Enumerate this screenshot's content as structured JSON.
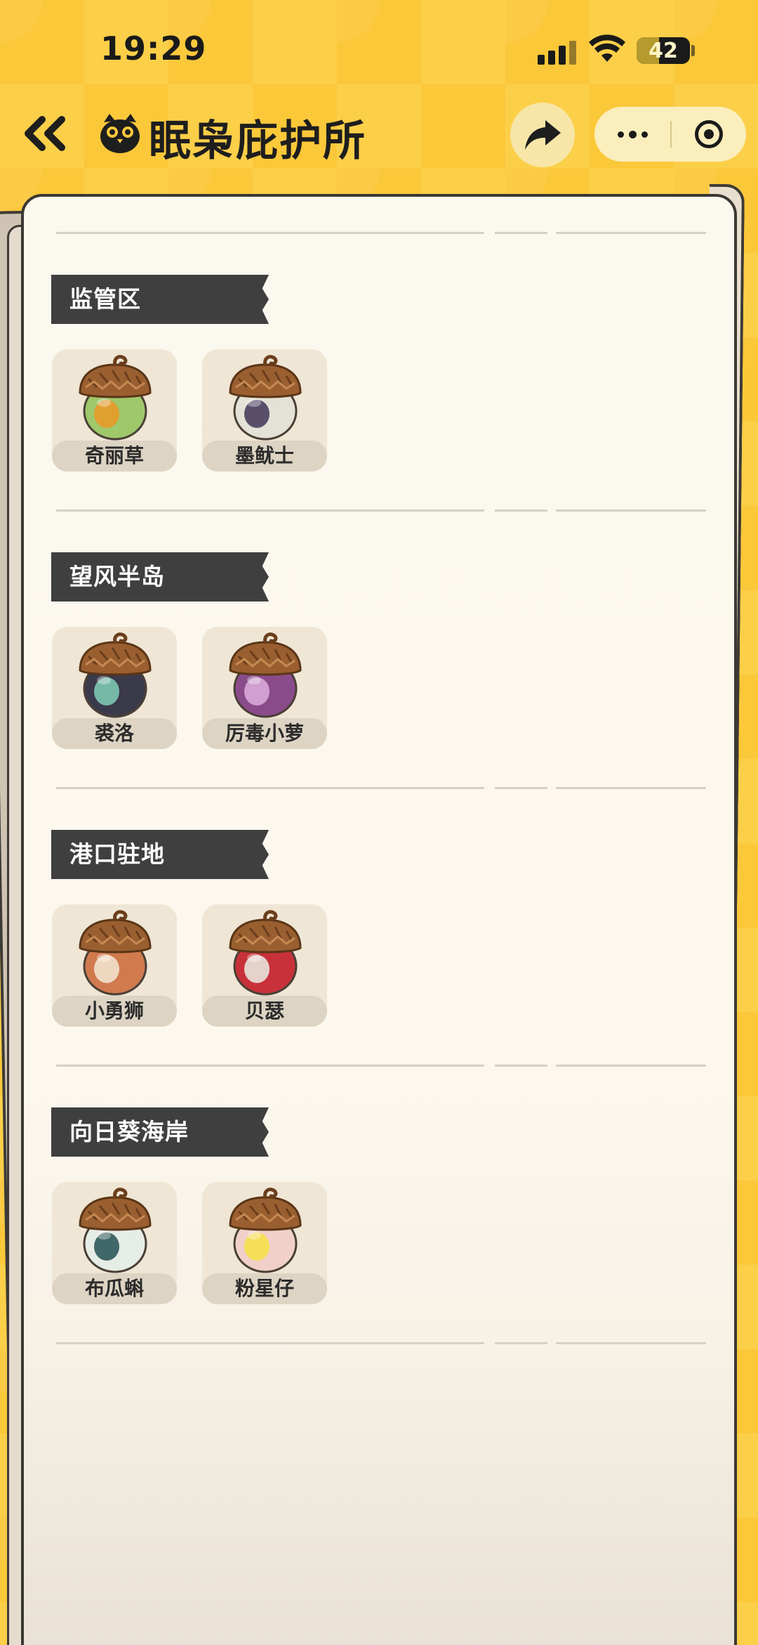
{
  "status_bar": {
    "time": "19:29",
    "battery": "42",
    "battery_percent": 42
  },
  "nav": {
    "title": "眠枭庇护所",
    "back_icon": "double-chevron-left-icon",
    "share_icon": "share-arrow-icon",
    "logo_icon": "owl-logo-icon"
  },
  "sections": [
    {
      "title": "监管区",
      "items": [
        {
          "name": "奇丽草",
          "body": "#9fc86a",
          "accent": "#e89a2a",
          "icon": "acorn-icon"
        },
        {
          "name": "墨鱿士",
          "body": "#e4e2d6",
          "accent": "#4a3f5e",
          "icon": "acorn-icon"
        }
      ]
    },
    {
      "title": "望风半岛",
      "items": [
        {
          "name": "裘洛",
          "body": "#3a3a4a",
          "accent": "#7ec7b1",
          "icon": "acorn-icon"
        },
        {
          "name": "厉毒小萝",
          "body": "#8a4b8a",
          "accent": "#d8a9d8",
          "icon": "acorn-icon"
        }
      ]
    },
    {
      "title": "港口驻地",
      "items": [
        {
          "name": "小勇狮",
          "body": "#d07a4e",
          "accent": "#f2e1cc",
          "icon": "acorn-icon"
        },
        {
          "name": "贝瑟",
          "body": "#c8313a",
          "accent": "#e8e4dc",
          "icon": "acorn-icon"
        }
      ]
    },
    {
      "title": "向日葵海岸",
      "items": [
        {
          "name": "布瓜蝌",
          "body": "#e6ece6",
          "accent": "#2f5a5a",
          "icon": "acorn-icon"
        },
        {
          "name": "粉星仔",
          "body": "#f0d0c8",
          "accent": "#f6e04a",
          "icon": "acorn-icon"
        }
      ]
    }
  ]
}
